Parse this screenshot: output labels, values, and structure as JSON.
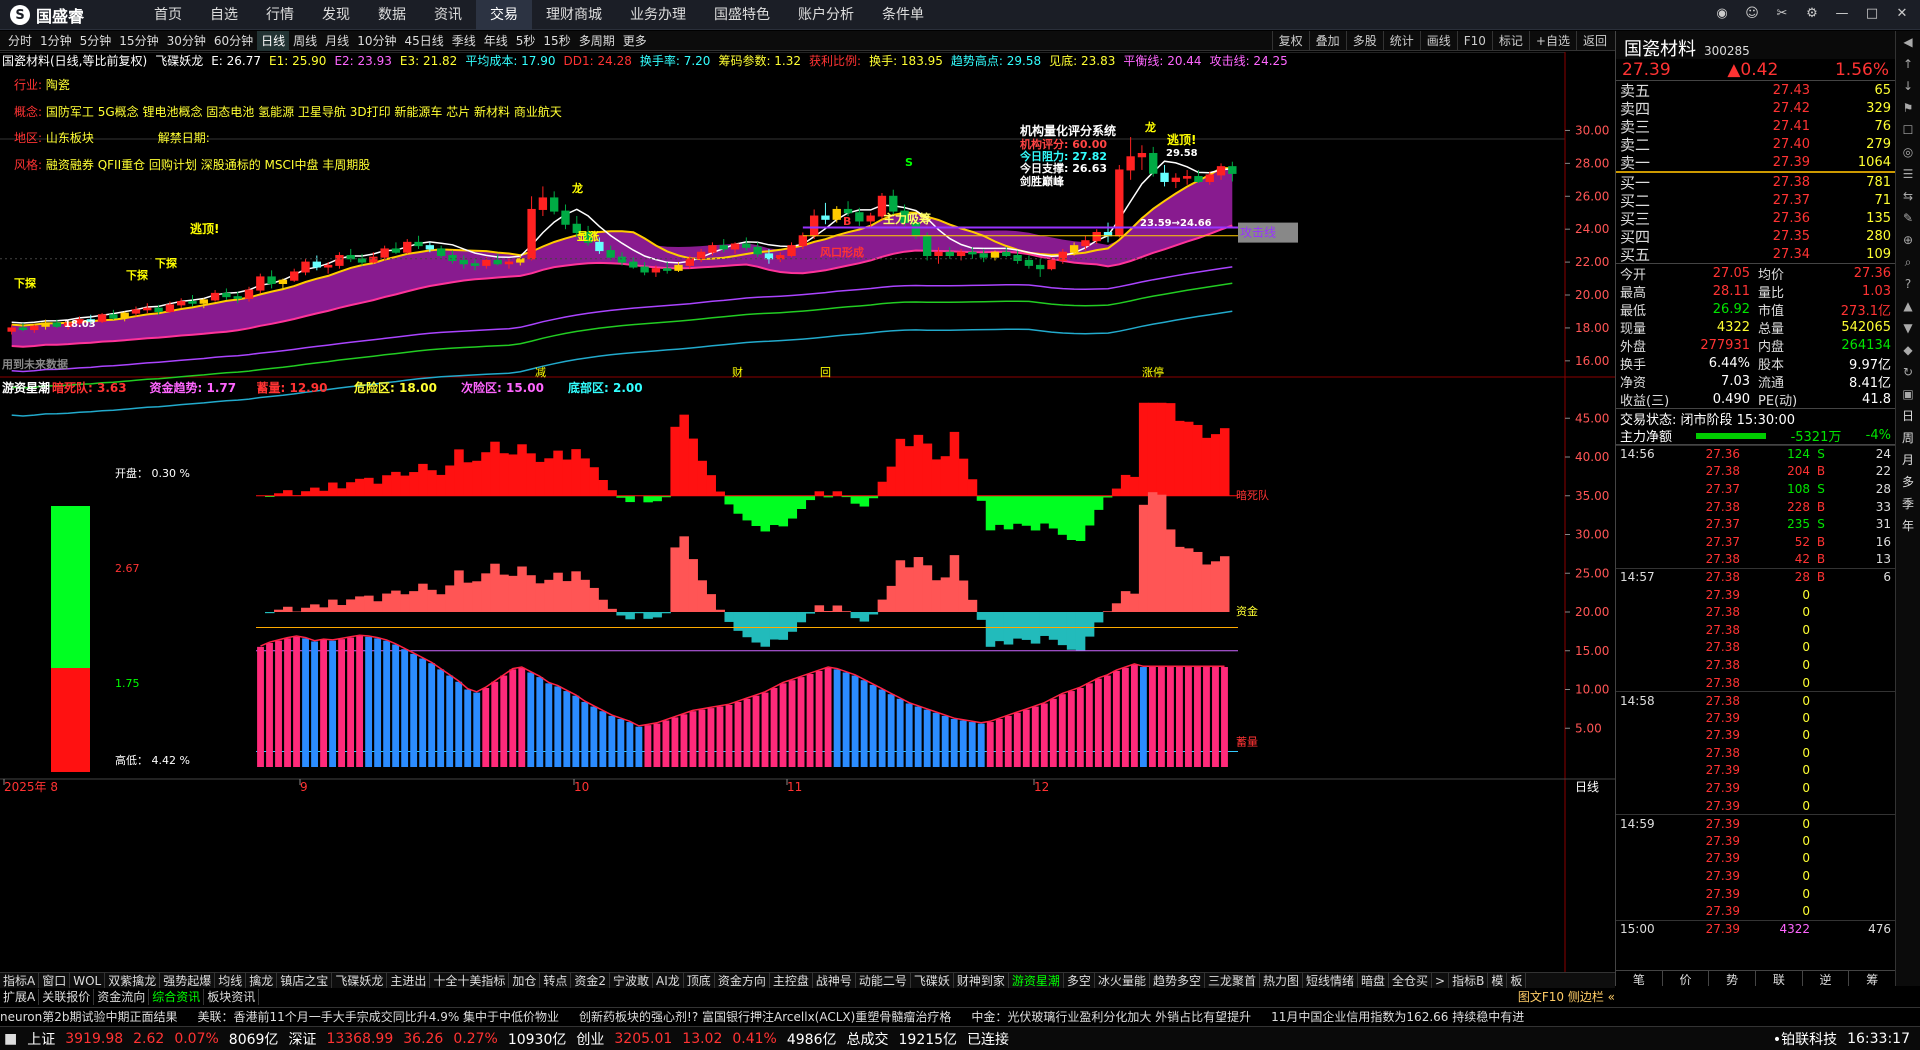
{
  "app": {
    "logo": "国盛睿",
    "menu": [
      "首页",
      "自选",
      "行情",
      "发现",
      "数据",
      "资讯",
      "交易",
      "理财商城",
      "业务办理",
      "国盛特色",
      "账户分析",
      "条件单"
    ],
    "active_menu": "交易"
  },
  "periods": [
    "分时",
    "1分钟",
    "5分钟",
    "15分钟",
    "30分钟",
    "60分钟",
    "日线",
    "周线",
    "月线",
    "10分钟",
    "45日线",
    "季线",
    "年线",
    "5秒",
    "15秒",
    "多周期",
    "更多"
  ],
  "active_period": "日线",
  "tools": [
    "复权",
    "叠加",
    "多股",
    "统计",
    "画线",
    "F10",
    "标记",
    "+自选",
    "返回"
  ],
  "legend1": [
    {
      "t": "国瓷材料(日线,等比前复权)",
      "c": "wht"
    },
    {
      "t": "飞碟妖龙",
      "c": "wht"
    },
    {
      "t": "E: 26.77",
      "c": "wht"
    },
    {
      "t": "E1: 25.90",
      "c": "yel"
    },
    {
      "t": "E2: 23.93",
      "c": "mag"
    },
    {
      "t": "E3: 21.82",
      "c": "yel"
    },
    {
      "t": "平均成本: 17.90",
      "c": "cyan"
    },
    {
      "t": "DD1: 24.28",
      "c": "red"
    },
    {
      "t": "换手率: 7.20",
      "c": "cyan"
    },
    {
      "t": "筹码参数: 1.32",
      "c": "yel"
    },
    {
      "t": "获利比例:",
      "c": "red"
    },
    {
      "t": "换手: 183.95",
      "c": "yel"
    },
    {
      "t": "趋势高点: 29.58",
      "c": "cyan"
    },
    {
      "t": "见底: 23.83",
      "c": "yel"
    },
    {
      "t": "平衡线: 20.44",
      "c": "mag"
    },
    {
      "t": "攻击线: 24.25",
      "c": "mag"
    }
  ],
  "info": {
    "industry_label": "行业:",
    "industry": "陶瓷",
    "concept_label": "概念:",
    "concept": "国防军工 5G概念 锂电池概念 固态电池 氢能源 卫星导航 3D打印 新能源车 芯片 新材料 商业航天",
    "region_label": "地区:",
    "region": "山东板块",
    "ban_label": "解禁日期:",
    "style_label": "风格:",
    "style": "融资融券 QFII重仓 回购计划 深股通标的 MSCI中盘 丰周期股"
  },
  "annot": {
    "score_title": "机构量化评分系统",
    "score": "机构评分:  60.00",
    "resist": "今日阻力:  27.82",
    "support": "今日支撑:  26.63",
    "peak": "剑胜巅峰",
    "escape1": "逃顶!",
    "escape2": "逃顶!",
    "high": "29.58",
    "low": "18.03",
    "xia1": "下探",
    "xia2": "下探",
    "xia3": "下探",
    "zhuli": "主力吸筹",
    "fengkou": "风口形成",
    "zhangting": "显涨",
    "gongji": "攻击线",
    "range": "23.59→24.66",
    "s_mark": "S",
    "long": "龙",
    "b_mark": "B",
    "event_labels": [
      "减",
      "财",
      "回",
      "涨停"
    ],
    "future_note": "用到未来数据"
  },
  "yaxis_top": [
    "30.00",
    "28.00",
    "26.00",
    "24.00",
    "22.00",
    "20.00",
    "18.00",
    "16.00"
  ],
  "yaxis_bot": [
    "45.00",
    "40.00",
    "35.00",
    "30.00",
    "25.00",
    "20.00",
    "15.00",
    "10.00",
    "5.00"
  ],
  "xaxis": [
    "2025年 8",
    "9",
    "10",
    "11",
    "12"
  ],
  "xaxis_right": "日线",
  "legend2": [
    {
      "t": "游资星潮",
      "c": "wht"
    },
    {
      "t": "暗死队: 3.63",
      "c": "red"
    },
    {
      "t": "资金趋势: 1.77",
      "c": "mag"
    },
    {
      "t": "蓄量: 12.90",
      "c": "red"
    },
    {
      "t": "危险区: 18.00",
      "c": "yel"
    },
    {
      "t": "次险区: 15.00",
      "c": "mag"
    },
    {
      "t": "底部区: 2.00",
      "c": "cyan"
    }
  ],
  "bot_labels": {
    "an": "暗死队",
    "zijin": "资金",
    "xuliang": "蓄量"
  },
  "leftbox": {
    "open": "开盘： 0.30 %",
    "v1": "2.67",
    "v2": "1.75",
    "high": "高低： 4.42 %"
  },
  "stock": {
    "name": "国瓷材料",
    "code": "300285",
    "price": "27.39",
    "chg": "▲0.42",
    "pct": "1.56%"
  },
  "asks": [
    [
      "卖五",
      "27.43",
      "65"
    ],
    [
      "卖四",
      "27.42",
      "329"
    ],
    [
      "卖三",
      "27.41",
      "76"
    ],
    [
      "卖二",
      "27.40",
      "279"
    ],
    [
      "卖一",
      "27.39",
      "1064"
    ]
  ],
  "bids": [
    [
      "买一",
      "27.38",
      "781"
    ],
    [
      "买二",
      "27.37",
      "71"
    ],
    [
      "买三",
      "27.36",
      "135"
    ],
    [
      "买四",
      "27.35",
      "280"
    ],
    [
      "买五",
      "27.34",
      "109"
    ]
  ],
  "stats": [
    [
      "今开",
      "27.05",
      "均价",
      "27.36"
    ],
    [
      "最高",
      "28.11",
      "量比",
      "1.03"
    ],
    [
      "最低",
      "26.92",
      "市值",
      "273.1亿"
    ],
    [
      "现量",
      "4322",
      "总量",
      "542065"
    ],
    [
      "外盘",
      "277931",
      "内盘",
      "264134"
    ],
    [
      "换手",
      "6.44%",
      "股本",
      "9.97亿"
    ],
    [
      "净资",
      "7.03",
      "流通",
      "8.41亿"
    ],
    [
      "收益(三)",
      "0.490",
      "PE(动)",
      "41.8"
    ]
  ],
  "trade_state": "交易状态: 闭市阶段 15:30:00",
  "netflow": {
    "label": "主力净额",
    "val": "-5321万",
    "pct": "-4%"
  },
  "ticks": [
    [
      "14:56",
      "27.36",
      "124",
      "S",
      "24"
    ],
    [
      "",
      "27.38",
      "204",
      "B",
      "22"
    ],
    [
      "",
      "27.37",
      "108",
      "S",
      "28"
    ],
    [
      "",
      "27.38",
      "228",
      "B",
      "33"
    ],
    [
      "",
      "27.37",
      "235",
      "S",
      "31"
    ],
    [
      "",
      "27.37",
      "52",
      "B",
      "16"
    ],
    [
      "",
      "27.38",
      "42",
      "B",
      "13"
    ],
    [
      "14:57",
      "27.38",
      "28",
      "B",
      "6"
    ],
    [
      "",
      "27.39",
      "0",
      "",
      ""
    ],
    [
      "",
      "27.38",
      "0",
      "",
      ""
    ],
    [
      "",
      "27.38",
      "0",
      "",
      ""
    ],
    [
      "",
      "27.38",
      "0",
      "",
      ""
    ],
    [
      "",
      "27.38",
      "0",
      "",
      ""
    ],
    [
      "",
      "27.38",
      "0",
      "",
      ""
    ],
    [
      "14:58",
      "27.38",
      "0",
      "",
      ""
    ],
    [
      "",
      "27.39",
      "0",
      "",
      ""
    ],
    [
      "",
      "27.39",
      "0",
      "",
      ""
    ],
    [
      "",
      "27.38",
      "0",
      "",
      ""
    ],
    [
      "",
      "27.39",
      "0",
      "",
      ""
    ],
    [
      "",
      "27.39",
      "0",
      "",
      ""
    ],
    [
      "",
      "27.39",
      "0",
      "",
      ""
    ],
    [
      "14:59",
      "27.39",
      "0",
      "",
      ""
    ],
    [
      "",
      "27.39",
      "0",
      "",
      ""
    ],
    [
      "",
      "27.39",
      "0",
      "",
      ""
    ],
    [
      "",
      "27.39",
      "0",
      "",
      ""
    ],
    [
      "",
      "27.39",
      "0",
      "",
      ""
    ],
    [
      "",
      "27.39",
      "0",
      "",
      ""
    ],
    [
      "15:00",
      "27.39",
      "4322",
      "",
      "476"
    ]
  ],
  "rp_bottom_tabs": [
    "笔",
    "价",
    "势",
    "联",
    "逆",
    "筹"
  ],
  "side": [
    "日",
    "周",
    "月",
    "多",
    "季",
    "年"
  ],
  "bottom_tabs": [
    "指标A",
    "窗口",
    "WOL",
    "双紫擒龙",
    "强势起爆",
    "均线",
    "擒龙",
    "镇店之宝",
    "飞碟妖龙",
    "主进出",
    "十全十美指标",
    "加仓",
    "转点",
    "资金2",
    "宁波敢",
    "AI龙",
    "顶底",
    "资金方向",
    "主控盘",
    "战神号",
    "动能二号",
    "飞碟妖",
    "财神到家",
    "游资星潮",
    "多空",
    "冰火量能",
    "趋势多空",
    "三龙聚首",
    "热力图",
    "短线情绪",
    "暗盘",
    "全仓买",
    ">",
    "指标B",
    "模",
    "板"
  ],
  "active_bottom": "游资星潮",
  "tabs2": [
    "扩展A",
    "关联报价",
    "资金流向",
    "综合资讯",
    "板块资讯"
  ],
  "tabs2_right": "图文F10 侧边栏 «",
  "news": [
    "neuron第2b期试验中期正面结果",
    "美联：香港前11个月一手大手宗成交同比升4.9% 集中于中低价物业",
    "创新药板块的强心剂!? 富国银行押注Arcellx(ACLX)重塑骨髓瘤治疗格",
    "中金：光伏玻璃行业盈利分化加大 外销占比有望提升",
    "11月中国企业信用指数为162.66 持续稳中有进"
  ],
  "status": {
    "sh_label": "上证",
    "sh": "3919.98",
    "sh_chg": "2.62",
    "sh_pct": "0.07%",
    "sh_amt": "8069亿",
    "sz_label": "深证",
    "sz": "13368.99",
    "sz_chg": "36.26",
    "sz_pct": "0.27%",
    "sz_amt": "10930亿",
    "cy_label": "创业",
    "cy": "3205.01",
    "cy_chg": "13.02",
    "cy_pct": "0.41%",
    "cy_amt": "4986亿",
    "tot_label": "总成交",
    "tot": "19215亿",
    "conn": "已连接",
    "broker": "•铂联科技",
    "time": "16:33:17"
  },
  "chart_data": {
    "type": "candlestick",
    "ylim": [
      15.2,
      31
    ],
    "volume_ylim": [
      0,
      48
    ],
    "candles": [
      [
        17.8,
        18.2,
        17.6,
        18.0
      ],
      [
        18.0,
        18.3,
        17.8,
        17.9
      ],
      [
        17.9,
        18.2,
        17.7,
        18.1
      ],
      [
        18.1,
        18.5,
        17.9,
        18.3
      ],
      [
        18.3,
        18.5,
        18.0,
        18.1
      ],
      [
        18.1,
        18.4,
        17.9,
        18.3
      ],
      [
        18.3,
        18.7,
        18.1,
        18.5
      ],
      [
        18.5,
        18.8,
        18.2,
        18.4
      ],
      [
        18.4,
        18.9,
        18.3,
        18.8
      ],
      [
        18.8,
        19.1,
        18.5,
        18.6
      ],
      [
        18.6,
        19.0,
        18.4,
        18.9
      ],
      [
        18.9,
        19.3,
        18.7,
        19.1
      ],
      [
        19.1,
        19.5,
        18.9,
        19.2
      ],
      [
        19.2,
        19.4,
        18.8,
        19.0
      ],
      [
        19.0,
        19.6,
        18.9,
        19.4
      ],
      [
        19.4,
        19.8,
        19.2,
        19.6
      ],
      [
        19.6,
        20.0,
        19.3,
        19.5
      ],
      [
        19.5,
        19.8,
        19.2,
        19.7
      ],
      [
        19.7,
        20.3,
        19.6,
        20.1
      ],
      [
        20.1,
        20.4,
        19.7,
        19.9
      ],
      [
        19.9,
        20.2,
        19.5,
        19.8
      ],
      [
        19.8,
        20.5,
        19.6,
        20.3
      ],
      [
        20.3,
        21.3,
        20.1,
        21.1
      ],
      [
        21.1,
        21.5,
        20.4,
        20.7
      ],
      [
        20.7,
        21.0,
        20.3,
        20.9
      ],
      [
        20.9,
        21.6,
        20.8,
        21.4
      ],
      [
        21.4,
        22.2,
        21.2,
        22.0
      ],
      [
        22.0,
        22.4,
        21.5,
        21.7
      ],
      [
        21.7,
        22.0,
        21.3,
        21.8
      ],
      [
        21.8,
        22.6,
        21.6,
        22.4
      ],
      [
        22.4,
        22.8,
        22.0,
        22.2
      ],
      [
        22.2,
        22.5,
        21.8,
        22.0
      ],
      [
        22.0,
        22.6,
        21.9,
        22.3
      ],
      [
        22.3,
        23.0,
        22.1,
        22.8
      ],
      [
        22.8,
        23.2,
        22.5,
        22.6
      ],
      [
        22.6,
        23.4,
        22.5,
        23.2
      ],
      [
        23.2,
        23.6,
        22.8,
        23.0
      ],
      [
        23.0,
        23.2,
        22.6,
        22.8
      ],
      [
        22.8,
        23.0,
        22.2,
        22.4
      ],
      [
        22.4,
        22.7,
        21.9,
        22.1
      ],
      [
        22.1,
        22.4,
        21.6,
        21.9
      ],
      [
        21.9,
        22.2,
        21.5,
        21.8
      ],
      [
        21.8,
        22.3,
        21.6,
        22.1
      ],
      [
        22.1,
        22.5,
        21.8,
        21.9
      ],
      [
        21.9,
        22.2,
        21.6,
        22.0
      ],
      [
        22.0,
        22.4,
        21.8,
        22.2
      ],
      [
        22.2,
        26.0,
        22.1,
        25.2
      ],
      [
        25.2,
        26.6,
        24.8,
        25.9
      ],
      [
        25.9,
        26.3,
        24.9,
        25.1
      ],
      [
        25.1,
        25.5,
        24.0,
        24.3
      ],
      [
        24.3,
        24.8,
        23.5,
        23.8
      ],
      [
        23.8,
        24.2,
        23.0,
        23.2
      ],
      [
        23.2,
        23.5,
        22.5,
        22.7
      ],
      [
        22.7,
        23.0,
        22.1,
        22.3
      ],
      [
        22.3,
        22.6,
        21.8,
        22.0
      ],
      [
        22.0,
        22.3,
        21.6,
        21.7
      ],
      [
        21.7,
        22.0,
        21.2,
        21.4
      ],
      [
        21.4,
        21.8,
        21.1,
        21.6
      ],
      [
        21.6,
        22.0,
        21.3,
        21.5
      ],
      [
        21.5,
        22.0,
        21.4,
        21.8
      ],
      [
        21.8,
        22.4,
        21.6,
        22.2
      ],
      [
        22.2,
        22.8,
        22.0,
        22.6
      ],
      [
        22.6,
        23.2,
        22.4,
        23.0
      ],
      [
        23.0,
        23.4,
        22.6,
        22.8
      ],
      [
        22.8,
        23.2,
        22.5,
        23.1
      ],
      [
        23.1,
        23.5,
        22.7,
        22.9
      ],
      [
        22.9,
        23.2,
        22.3,
        22.5
      ],
      [
        22.5,
        22.8,
        21.9,
        22.2
      ],
      [
        22.2,
        22.6,
        22.0,
        22.4
      ],
      [
        22.4,
        23.2,
        22.3,
        23.0
      ],
      [
        23.0,
        23.8,
        22.8,
        23.6
      ],
      [
        23.6,
        25.2,
        23.4,
        24.8
      ],
      [
        24.8,
        25.6,
        24.3,
        24.6
      ],
      [
        24.6,
        25.4,
        24.4,
        25.2
      ],
      [
        25.2,
        25.7,
        24.8,
        25.0
      ],
      [
        25.0,
        25.3,
        24.2,
        24.5
      ],
      [
        24.5,
        25.0,
        24.1,
        24.8
      ],
      [
        24.8,
        26.2,
        24.6,
        26.0
      ],
      [
        26.0,
        26.4,
        24.9,
        25.1
      ],
      [
        25.1,
        25.5,
        24.2,
        24.4
      ],
      [
        24.4,
        24.6,
        23.4,
        23.6
      ],
      [
        23.6,
        23.8,
        22.1,
        22.4
      ],
      [
        22.4,
        22.9,
        21.9,
        22.6
      ],
      [
        22.6,
        22.9,
        22.2,
        22.4
      ],
      [
        22.4,
        22.8,
        22.1,
        22.6
      ],
      [
        22.6,
        22.9,
        22.2,
        22.5
      ],
      [
        22.5,
        22.8,
        22.0,
        22.3
      ],
      [
        22.3,
        22.7,
        22.1,
        22.6
      ],
      [
        22.6,
        22.9,
        22.3,
        22.4
      ],
      [
        22.4,
        22.7,
        21.9,
        22.1
      ],
      [
        22.1,
        22.4,
        21.6,
        21.8
      ],
      [
        21.8,
        22.2,
        21.1,
        21.6
      ],
      [
        21.6,
        22.3,
        21.5,
        22.1
      ],
      [
        22.1,
        22.8,
        21.9,
        22.6
      ],
      [
        22.6,
        23.2,
        22.4,
        23.0
      ],
      [
        23.0,
        23.6,
        22.7,
        23.3
      ],
      [
        23.3,
        24.0,
        23.1,
        23.8
      ],
      [
        23.8,
        24.4,
        23.2,
        23.6
      ],
      [
        23.6,
        27.9,
        23.5,
        27.6
      ],
      [
        27.6,
        29.6,
        27.0,
        28.4
      ],
      [
        28.4,
        29.1,
        27.6,
        28.6
      ],
      [
        28.6,
        29.0,
        27.2,
        27.4
      ],
      [
        27.4,
        27.9,
        26.6,
        26.9
      ],
      [
        26.9,
        27.4,
        26.5,
        27.1
      ],
      [
        27.1,
        27.6,
        26.7,
        27.2
      ],
      [
        27.2,
        27.6,
        26.8,
        26.9
      ],
      [
        26.9,
        27.5,
        26.7,
        27.3
      ],
      [
        27.3,
        28.0,
        27.0,
        27.8
      ],
      [
        27.8,
        28.1,
        26.9,
        27.39
      ]
    ],
    "volume": [
      15.5,
      16,
      16.3,
      16.6,
      16.8,
      16.6,
      16.2,
      16.4,
      16.3,
      16.5,
      16.7,
      16.9,
      16.8,
      16.6,
      16.3,
      15.8,
      15.2,
      14.6,
      14,
      13.4,
      12.6,
      11.8,
      11,
      10,
      9.6,
      10.2,
      11,
      11.8,
      12.6,
      12.8,
      12.2,
      11.6,
      10.8,
      10.4,
      9.8,
      9.2,
      8.4,
      7.8,
      7.2,
      6.6,
      6.2,
      5.8,
      5.2,
      5.4,
      5.6,
      6,
      6.4,
      6.8,
      7.2,
      7.4,
      7.6,
      7.8,
      8,
      8.4,
      8.8,
      9.2,
      9.6,
      10.2,
      10.8,
      11.2,
      11.6,
      12,
      12.4,
      12.8,
      12.6,
      12.2,
      11.8,
      11.2,
      10.6,
      10,
      9.4,
      8.8,
      8.2,
      7.8,
      7.4,
      7,
      6.6,
      6.2,
      6,
      5.8,
      5.6,
      5.8,
      6.2,
      6.6,
      7,
      7.4,
      7.8,
      8.2,
      8.8,
      9.4,
      9.8,
      10.2,
      10.8,
      11.4,
      11.8,
      12.4,
      12.8,
      13.2,
      12.9,
      12.9,
      12.9,
      12.9,
      12.9,
      12.9,
      12.9,
      12.9,
      12.9,
      12.9
    ]
  }
}
